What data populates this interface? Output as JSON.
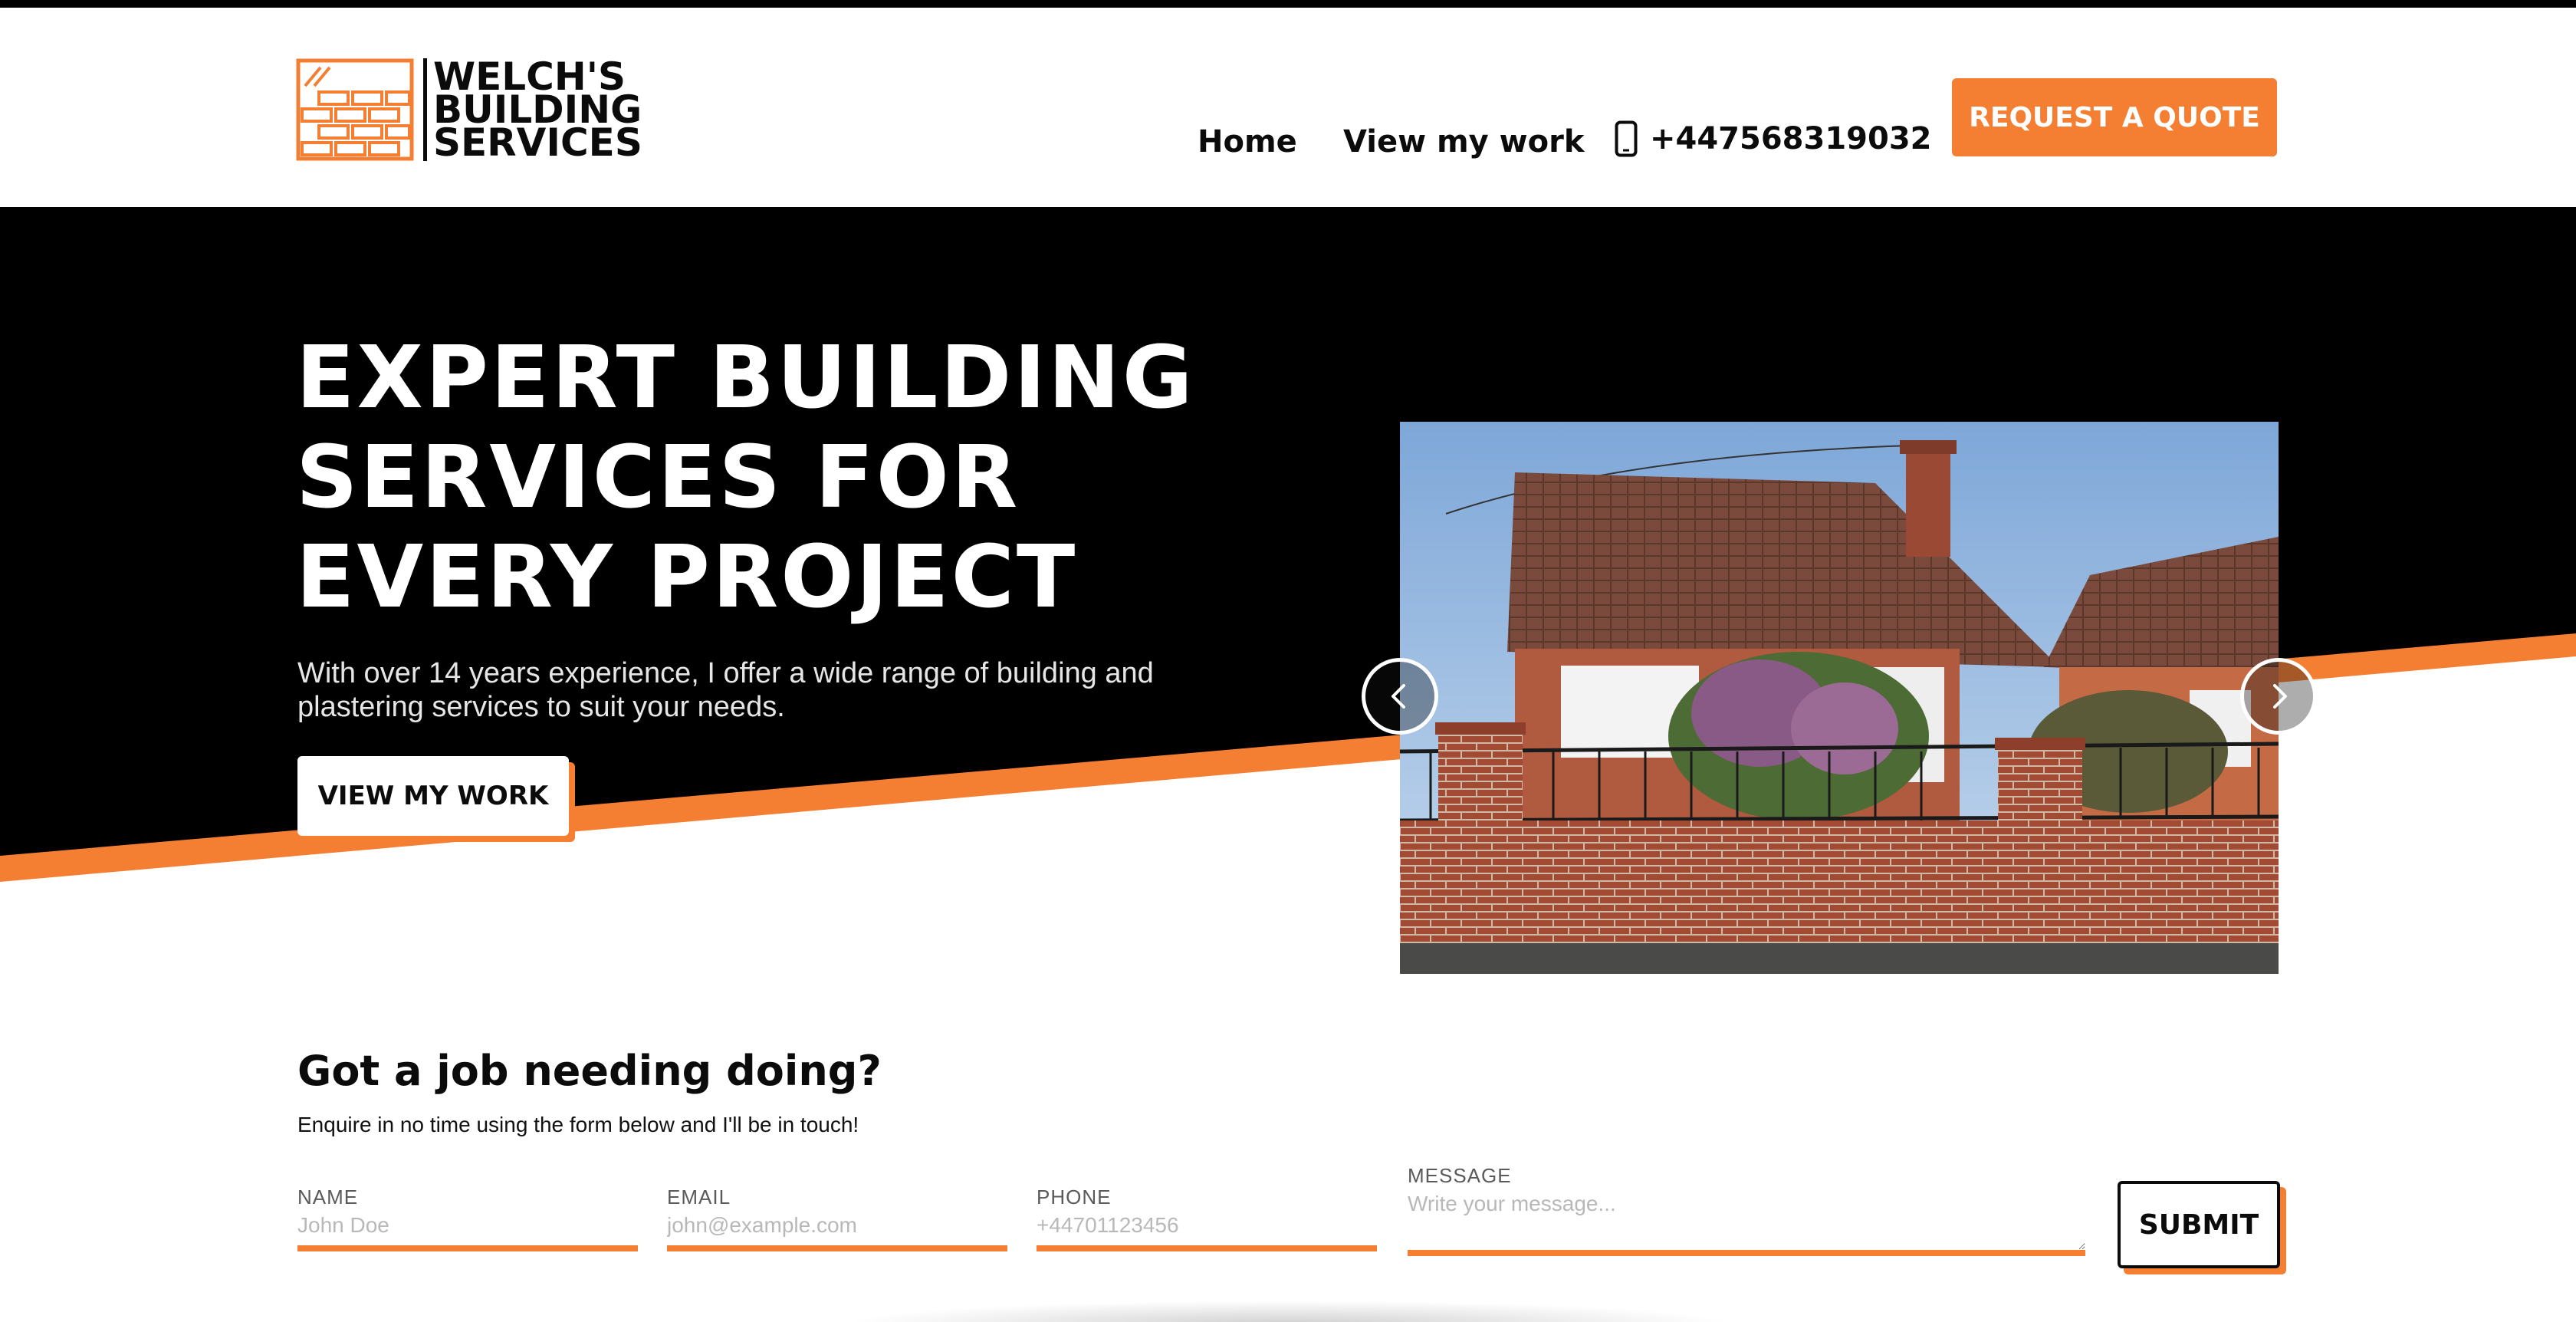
{
  "header": {
    "logo_lines": [
      "WELCH'S",
      "BUILDING",
      "SERVICES"
    ],
    "nav": {
      "home": "Home",
      "work": "View my work",
      "phone": "+447568319032"
    },
    "quote_button": "REQUEST A QUOTE"
  },
  "hero": {
    "title_lines": [
      "EXPERT BUILDING",
      "SERVICES FOR",
      "EVERY PROJECT"
    ],
    "subtitle": "With over 14 years experience, I offer a wide range of building and plastering services to suit your needs.",
    "cta": "VIEW MY WORK"
  },
  "carousel": {
    "prev_icon": "chevron-left-icon",
    "next_icon": "chevron-right-icon"
  },
  "form": {
    "title": "Got a job needing doing?",
    "subtitle": "Enquire in no time using the form below and I'll be in touch!",
    "fields": {
      "name": {
        "label": "NAME",
        "placeholder": "John Doe",
        "value": ""
      },
      "email": {
        "label": "EMAIL",
        "placeholder": "john@example.com",
        "value": ""
      },
      "phone": {
        "label": "PHONE",
        "placeholder": "+44701123456",
        "value": ""
      },
      "message": {
        "label": "MESSAGE",
        "placeholder": "Write your message...",
        "value": ""
      }
    },
    "submit": "SUBMIT"
  },
  "colors": {
    "accent": "#f47f33",
    "dark": "#0b0b0b",
    "background": "#ffffff"
  }
}
